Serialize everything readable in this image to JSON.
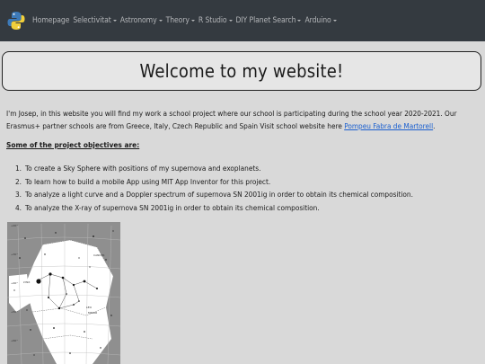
{
  "navbar": {
    "logo_icon": "python-logo-icon",
    "items": [
      {
        "label": "Homepage",
        "dropdown": false
      },
      {
        "label": "Selectivitat",
        "dropdown": true
      },
      {
        "label": "Astronomy",
        "dropdown": true
      },
      {
        "label": "Theory",
        "dropdown": true
      },
      {
        "label": "R Studio",
        "dropdown": true
      },
      {
        "label": "DIY Planet Search",
        "dropdown": true
      },
      {
        "label": "Arduino",
        "dropdown": true
      }
    ],
    "background": "#343a40",
    "text_color": "#b3b5b8"
  },
  "banner": {
    "title": "Welcome to my website!"
  },
  "intro": {
    "text": "I'm Josep, in this website you will find my work a school project where our school is participating during the school year 2020-2021. Our Erasmus+ partner schools are from Greece, Italy, Czech Republic and Spain Visit school website here ",
    "link_label": "Pompeu Fabra de Martorell",
    "after_link": "."
  },
  "objectives": {
    "title": "Some of the project objectives are:",
    "items": [
      {
        "num": "1.",
        "text": "To create a Sky Sphere with positions of my supernova and exoplanets."
      },
      {
        "num": "2.",
        "text": "To learn how to build a mobile App using MIT App Inventor for this project."
      },
      {
        "num": "3.",
        "text": "To analyze a light curve and a Doppler spectrum of supernova SN 2001ig in order to obtain its chemical composition."
      },
      {
        "num": "4.",
        "text": "To analyze the X-ray of supernova SN 2001ig in order to obtain its chemical composition."
      }
    ]
  },
  "starmap": {
    "description_icon": "constellation-star-chart-image"
  },
  "colors": {
    "page_background": "#d9d9d9",
    "link": "#1a5fcf"
  }
}
